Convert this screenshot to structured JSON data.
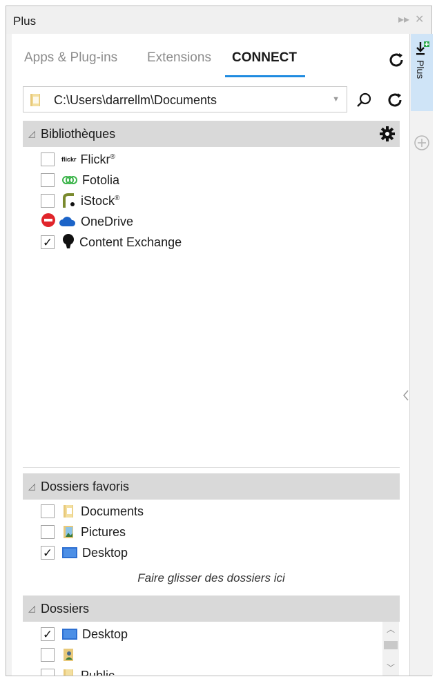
{
  "window": {
    "title": "Plus"
  },
  "tabs": [
    {
      "label": "Apps & Plug-ins"
    },
    {
      "label": "Extensions"
    },
    {
      "label": "CONNECT",
      "active": true
    }
  ],
  "pathbar": {
    "value": "C:\\Users\\darrellm\\Documents"
  },
  "libraries": {
    "header": "Bibliothèques",
    "items": [
      {
        "label": "Flickr",
        "sup": "®",
        "checked": false,
        "logo": "flickr"
      },
      {
        "label": "Fotolia",
        "sup": "",
        "checked": false,
        "logo": "fotolia"
      },
      {
        "label": "iStock",
        "sup": "®",
        "checked": false,
        "logo": "istock"
      },
      {
        "label": "OneDrive",
        "sup": "",
        "checked": false,
        "blocked": true,
        "logo": "onedrive"
      },
      {
        "label": "Content Exchange",
        "sup": "",
        "checked": true,
        "logo": "content-exchange"
      }
    ]
  },
  "favorites": {
    "header": "Dossiers favoris",
    "items": [
      {
        "label": "Documents",
        "checked": false
      },
      {
        "label": "Pictures",
        "checked": false
      },
      {
        "label": "Desktop",
        "checked": true
      }
    ],
    "drop_hint": "Faire glisser des dossiers ici"
  },
  "folders": {
    "header": "Dossiers",
    "items": [
      {
        "label": "Desktop",
        "checked": true
      },
      {
        "label": "",
        "checked": false
      },
      {
        "label": "Public",
        "checked": false
      }
    ]
  },
  "sidebar": {
    "tab_label": "Plus"
  },
  "colors": {
    "accent": "#1f8be0",
    "header_bg": "#d9d9d9",
    "sidebar_tab_bg": "#cfe4f7",
    "blocked_red": "#e0252b",
    "onedrive_blue": "#1c64c8"
  }
}
